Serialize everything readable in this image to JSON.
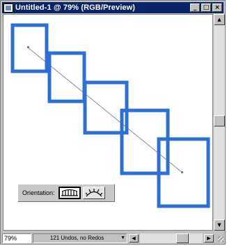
{
  "window": {
    "title": "Untitled-1 @ 79% (RGB/Preview)",
    "minimize": "_",
    "maximize": "□",
    "close": "×"
  },
  "colors": {
    "frame": "#2e6fd6",
    "path": "#8c8c8c"
  },
  "artwork": {
    "frame_count": 5,
    "frame_color": "#2e6fd6"
  },
  "orientation": {
    "label": "Orientation:",
    "options": [
      "align-to-path-icon",
      "rotate-arc-icon"
    ],
    "selected": 0
  },
  "status": {
    "zoom": "79%",
    "message": "121 Undos, no Redos"
  }
}
